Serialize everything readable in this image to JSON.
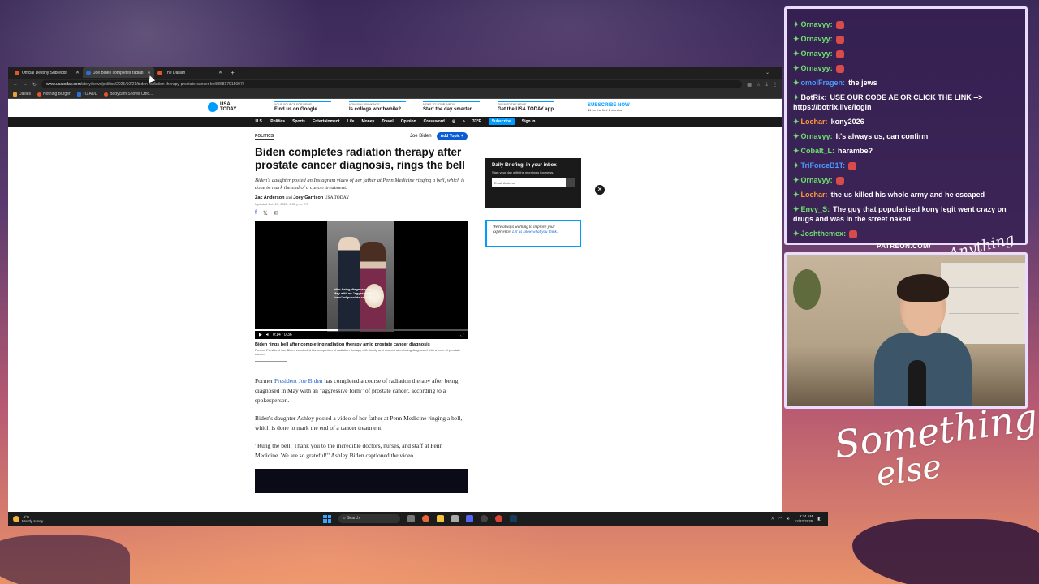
{
  "browser": {
    "tabs": [
      {
        "label": "Official Destiny Subreddit",
        "active": false
      },
      {
        "label": "Joe Biden completes radiati",
        "active": true
      },
      {
        "label": "The Dailian",
        "active": false
      }
    ],
    "url_host": "www.usatoday.com",
    "url_path": "/story/news/politics/2025/10/21/biden-radiation-therapy-prostate-cancer-bell/86817915007/",
    "bookmarks": [
      "Dailies",
      "Nothing Burger",
      "TO ADD",
      "Bodycam Shows Offic..."
    ]
  },
  "site": {
    "logo_line1": "USA",
    "logo_line2": "TODAY",
    "promos": [
      {
        "kicker": "Your source for news",
        "head": "Find us on Google"
      },
      {
        "kicker": "How poll rankings",
        "head": "Is college worthwhile?"
      },
      {
        "kicker": "News to your inbox",
        "head": "Start the day smarter"
      },
      {
        "kicker": "Tap into the news",
        "head": "Get the USA TODAY app"
      }
    ],
    "subscribe_head": "SUBSCRIBE NOW",
    "subscribe_sub": "$1 for the first 6 months",
    "nav": [
      "U.S.",
      "Politics",
      "Sports",
      "Entertainment",
      "Life",
      "Money",
      "Travel",
      "Opinion",
      "Crossword"
    ],
    "nav_temp": "33°F",
    "nav_subscribe": "Subscribe",
    "nav_signin": "Sign In"
  },
  "article": {
    "category": "POLITICS",
    "topic": "Joe Biden",
    "add_topic": "Add Topic +",
    "headline": "Biden completes radiation therapy after prostate cancer diagnosis, rings the bell",
    "dek": "Biden's daughter posted an Instagram video of her father at Penn Medicine ringing a bell, which is done to mark the end of a cancer treatment.",
    "author1": "Zac Anderson",
    "and": "and",
    "author2": "Joey Garrison",
    "outlet": "USA TODAY",
    "updated": "Updated Oct. 21, 2025, 8:38 p.m. ET",
    "video_overlay_text": "after being diagnosed in May with an \"aggressive form\" of prostate cancer.",
    "video_time": "0:14 / 0:36",
    "video_progress": 0.39,
    "video_caption": "Biden rings bell after completing radiation therapy amid prostate cancer diagnosis",
    "video_desc": "Former President Joe Biden concluded his completion of radiation therapy with family and doctors after being diagnosed with a form of prostate cancer.",
    "p1_pre": "Former",
    "p1_link": "President Joe Biden",
    "p1_post": "has completed a course of radiation therapy after being diagnosed in May with an \"aggressive form\" of prostate cancer, according to a spokesperson.",
    "p2": "Biden's daughter Ashley posted a video of her father at Penn Medicine ringing a bell, which is done to mark the end of a cancer treatment.",
    "p3": "\"Rung the bell! Thank you to the incredible doctors, nurses, and staff at Penn Medicine. We are so grateful!\" Ashley Biden captioned the video."
  },
  "sidebar": {
    "newsletter_title": "Daily Briefing, in your inbox",
    "newsletter_desc": "Start your day with the morning's top news.",
    "email_placeholder": "Email Address",
    "survey_text": "We're always working to improve your experience.",
    "survey_link": "Let us know what you think."
  },
  "taskbar": {
    "temp": "-4°C",
    "weather": "Mostly sunny",
    "search": "Search",
    "time": "9:24 AM",
    "date": "12/22/2025"
  },
  "chat": [
    {
      "user": "Ornavyy:",
      "text": "",
      "color": "#6ee06e"
    },
    {
      "user": "Ornavyy:",
      "text": "",
      "color": "#6ee06e"
    },
    {
      "user": "Ornavyy:",
      "text": "",
      "color": "#6ee06e"
    },
    {
      "user": "Ornavyy:",
      "text": "",
      "color": "#6ee06e"
    },
    {
      "user": "omolFragen:",
      "text": "the jews",
      "color": "#4a9bff"
    },
    {
      "user": "BotRix:",
      "text": "USE OUR CODE AE OR CLICK THE LINK --> https://botrix.live/login",
      "color": "#ffffff"
    },
    {
      "user": "Lochar:",
      "text": "kony2026",
      "color": "#ff9a3a"
    },
    {
      "user": "Ornavyy:",
      "text": "It's always us, can confirm",
      "color": "#6ee06e"
    },
    {
      "user": "Cobalt_L:",
      "text": "harambe?",
      "color": "#6ee06e"
    },
    {
      "user": "TriForceB1T:",
      "text": "",
      "color": "#4a9bff"
    },
    {
      "user": "Ornavyy:",
      "text": "",
      "color": "#6ee06e"
    },
    {
      "user": "Lochar:",
      "text": "the us killed his whole army and he escaped",
      "color": "#ff9a3a"
    },
    {
      "user": "Envy_S:",
      "text": "The guy that popularised kony legit went crazy on drugs and was in the street naked",
      "color": "#6ee06e"
    },
    {
      "user": "Joshthemex:",
      "text": "",
      "color": "#6ee06e"
    }
  ],
  "overlay": {
    "patreon": "PATREON.COM/",
    "signature": "Anything Else",
    "brand_line1": "Something",
    "brand_line2": "else"
  }
}
